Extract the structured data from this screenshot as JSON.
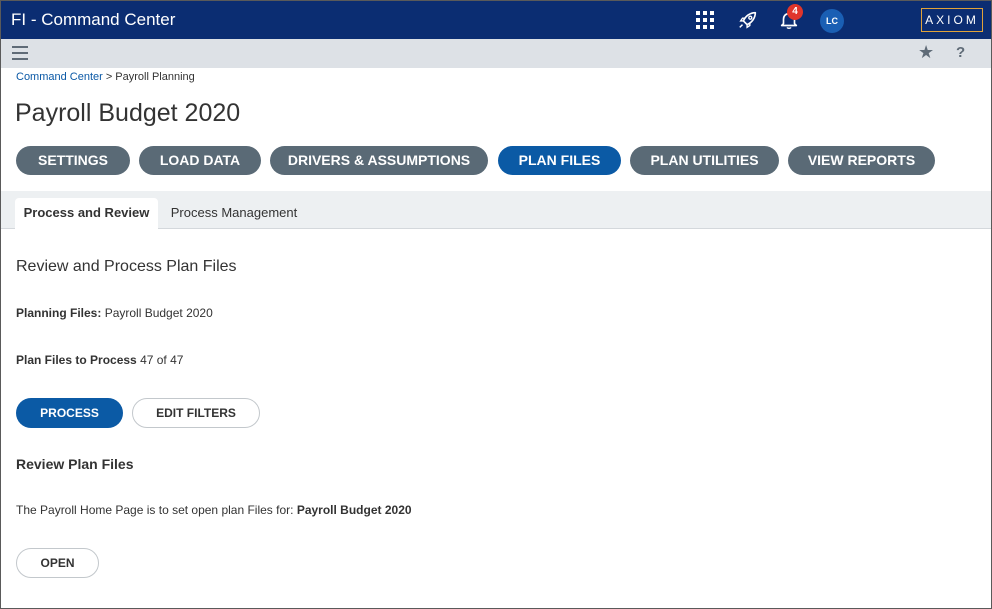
{
  "app": {
    "title": "FI - Command Center",
    "logo_text": "AXIOM"
  },
  "topbar": {
    "notifications_count": "4",
    "avatar_initials": "LC"
  },
  "breadcrumb": {
    "root": "Command Center",
    "separator": ">",
    "current": "Payroll Planning"
  },
  "page": {
    "title": "Payroll Budget 2020"
  },
  "nav": {
    "settings": "SETTINGS",
    "load_data": "LOAD DATA",
    "drivers": "DRIVERS & ASSUMPTIONS",
    "plan_files": "PLAN FILES",
    "plan_utilities": "PLAN UTILITIES",
    "view_reports": "VIEW REPORTS",
    "active": "PLAN FILES"
  },
  "tabs": {
    "process_review": "Process and Review",
    "process_management": "Process Management",
    "active": "Process and Review"
  },
  "content": {
    "section_title": "Review and Process Plan Files",
    "planning_files_label": "Planning Files:",
    "planning_files_value": "Payroll Budget 2020",
    "plan_files_to_process_label": "Plan Files to Process",
    "plan_files_to_process_value": "47 of 47",
    "process_button": "PROCESS",
    "edit_filters_button": "EDIT FILTERS",
    "review_heading": "Review Plan Files",
    "review_desc": "The Payroll Home Page is to set open plan Files for:",
    "review_desc_value": "Payroll Budget 2020",
    "open_button": "OPEN"
  },
  "colors": {
    "topbar_bg": "#0b2d72",
    "primary": "#0b5aa5",
    "nav_pill": "#5a6a76",
    "badge": "#e0352b",
    "logo_border": "#e0a23a"
  },
  "icons": {
    "apps": "grid-icon",
    "launch": "rocket-icon",
    "notifications": "bell-icon",
    "menu": "hamburger-icon",
    "favorite": "star-icon",
    "help": "help-icon"
  }
}
